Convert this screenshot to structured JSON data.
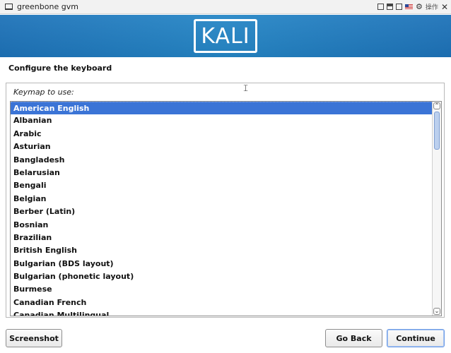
{
  "window": {
    "title": "greenbone gvm",
    "control_label": "操作"
  },
  "banner": {
    "logo_text": "KALI",
    "color": "#1f78bd"
  },
  "page": {
    "heading": "Configure the keyboard",
    "prompt": "Keymap to use:"
  },
  "keymap": {
    "selected": "American English",
    "items": [
      "American English",
      "Albanian",
      "Arabic",
      "Asturian",
      "Bangladesh",
      "Belarusian",
      "Bengali",
      "Belgian",
      "Berber (Latin)",
      "Bosnian",
      "Brazilian",
      "British English",
      "Bulgarian (BDS layout)",
      "Bulgarian (phonetic layout)",
      "Burmese",
      "Canadian French",
      "Canadian Multilingual"
    ]
  },
  "buttons": {
    "screenshot": "Screenshot",
    "go_back": "Go Back",
    "continue": "Continue"
  },
  "colors": {
    "selection": "#3b74d6",
    "accent_border": "#6d9be6"
  }
}
